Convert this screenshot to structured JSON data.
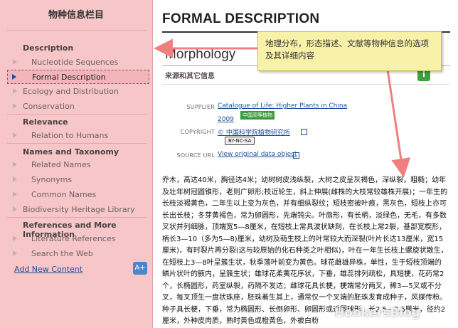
{
  "sidebar": {
    "title": "物种信息栏目",
    "sections": {
      "description": "Description",
      "relevance": "Relevance",
      "names": "Names and Taxonomy",
      "references": "References and More Information"
    },
    "items": {
      "nucleotide": "Nucleotide Sequences",
      "formal": "Formal Description",
      "ecology": "Ecology and Distribution",
      "conservation": "Conservation",
      "relation": "Relation to Humans",
      "related_names": "Related Names",
      "synonyms": "Synonyms",
      "common_names": "Common Names",
      "bhl": "Biodiversity Heritage Library",
      "lit_refs": "Literature References",
      "search_web": "Search the Web"
    },
    "add_new": "Add New Content",
    "add_icon": "add-content-icon"
  },
  "main": {
    "title": "FORMAL DESCRIPTION",
    "section": "Morphology",
    "subsection": "来源和其它信息",
    "info_icon": "info-icon",
    "supplier_label": "SUPPLIER",
    "supplier_value": "Catalogue of Life: Higher Plants in China",
    "supplier_year": "2009",
    "supplier_badge": "中国高等植物",
    "copyright_label": "COPYRIGHT",
    "copyright_value": "© 中国科学院植物研究所",
    "license_badge": "BY-NC-SA",
    "source_label": "SOURCE URL",
    "source_value": "View original data object",
    "body": "乔木，高达40米，胸径达4米；幼树树皮浅纵裂，大树之皮呈灰褐色，深纵裂，粗糙；幼年及壮年树冠圆锥形，老则广卵形;枝近轮生，斜上伸展(雌株的大枝常较雄株开展)；一年生的长枝淡褐黄色，二年生以上变为灰色，并有细纵裂纹；短枝密被叶痕，黑灰色，短枝上亦可长出长枝；冬芽黄褐色，常为卵圆形，先端钝尖。叶扇形，有长柄，淡绿色，无毛，有多数叉状并列细脉，顶端宽5—8厘米，在短枝上常具波状缺刻，在长枝上常2裂，基部宽楔形，柄长3—10（多为5—8)厘米，幼树及萌生枝上的叶常较大而深裂(叶片长达13厘米，宽15厘米)，有时裂片再分裂(这与较原始的化石种类之叶相似)，叶在一年生长枝上螺旋状散生，在短枝上3—8叶呈簇生状，秋季落叶前变为黄色。球花雌雄异株，单性，生于短枝顶端的鳞片状叶的腋内，呈簇生状；雄球花柔荑花序状，下垂，雄蕊排列疏松，具短梗，花药常2个，长椭圆形，药室纵裂，药隔不发达；雌球花具长梗，梗端常分两叉，稀3—5叉或不分叉，每叉顶生一盘状珠座，胚珠着生其上，通常仅一个叉端的胚珠发育成种子，风媒传粉。种子具长梗，下垂，常为椭圆形、长倒卵形、卵圆形或近圆球形，长2.5—3.5厘米，径约2厘米，外种皮肉质，熟时黄色或橙黄色，外被白粉"
  },
  "callout": {
    "text": "地理分布，形态描述、文献等物种信息的选项及其详细内容"
  },
  "watermark": "HookersBlog",
  "colors": {
    "sidebar_bg": "#f6c6c8",
    "link": "#1d4f9a",
    "callout_bg": "#f8f1a8",
    "arrow": "#f08080",
    "info_green": "#41a040"
  }
}
